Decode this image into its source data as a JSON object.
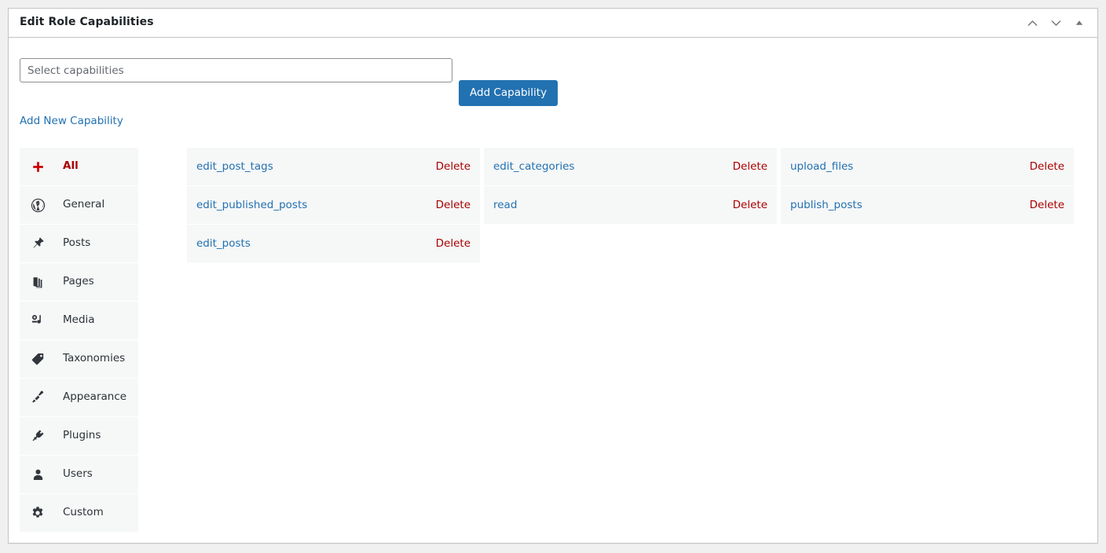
{
  "panel": {
    "title": "Edit Role Capabilities",
    "header_actions": [
      {
        "name": "move-up-icon",
        "label": "Move up"
      },
      {
        "name": "move-down-icon",
        "label": "Move down"
      },
      {
        "name": "toggle-panel-icon",
        "label": "Toggle panel"
      }
    ]
  },
  "toolbar": {
    "select_placeholder": "Select capabilities",
    "select_value": "",
    "add_capability_label": "Add Capability",
    "add_new_capability_label": "Add New Capability",
    "accent_color": "#2271b1",
    "danger_color": "#a00"
  },
  "sidebar": {
    "items": [
      {
        "label": "All",
        "icon": "plus-icon",
        "active": true
      },
      {
        "label": "General",
        "icon": "wordpress-icon",
        "active": false
      },
      {
        "label": "Posts",
        "icon": "pin-icon",
        "active": false
      },
      {
        "label": "Pages",
        "icon": "pages-icon",
        "active": false
      },
      {
        "label": "Media",
        "icon": "media-icon",
        "active": false
      },
      {
        "label": "Taxonomies",
        "icon": "tag-icon",
        "active": false
      },
      {
        "label": "Appearance",
        "icon": "paintbrush-icon",
        "active": false
      },
      {
        "label": "Plugins",
        "icon": "plug-icon",
        "active": false
      },
      {
        "label": "Users",
        "icon": "user-icon",
        "active": false
      },
      {
        "label": "Custom",
        "icon": "gear-icon",
        "active": false
      }
    ]
  },
  "capabilities": {
    "delete_label": "Delete",
    "columns": [
      {
        "rows": [
          {
            "name": "edit_post_tags"
          },
          {
            "name": "edit_published_posts"
          },
          {
            "name": "edit_posts"
          }
        ]
      },
      {
        "rows": [
          {
            "name": "edit_categories"
          },
          {
            "name": "read"
          }
        ]
      },
      {
        "rows": [
          {
            "name": "upload_files"
          },
          {
            "name": "publish_posts"
          }
        ]
      }
    ]
  }
}
